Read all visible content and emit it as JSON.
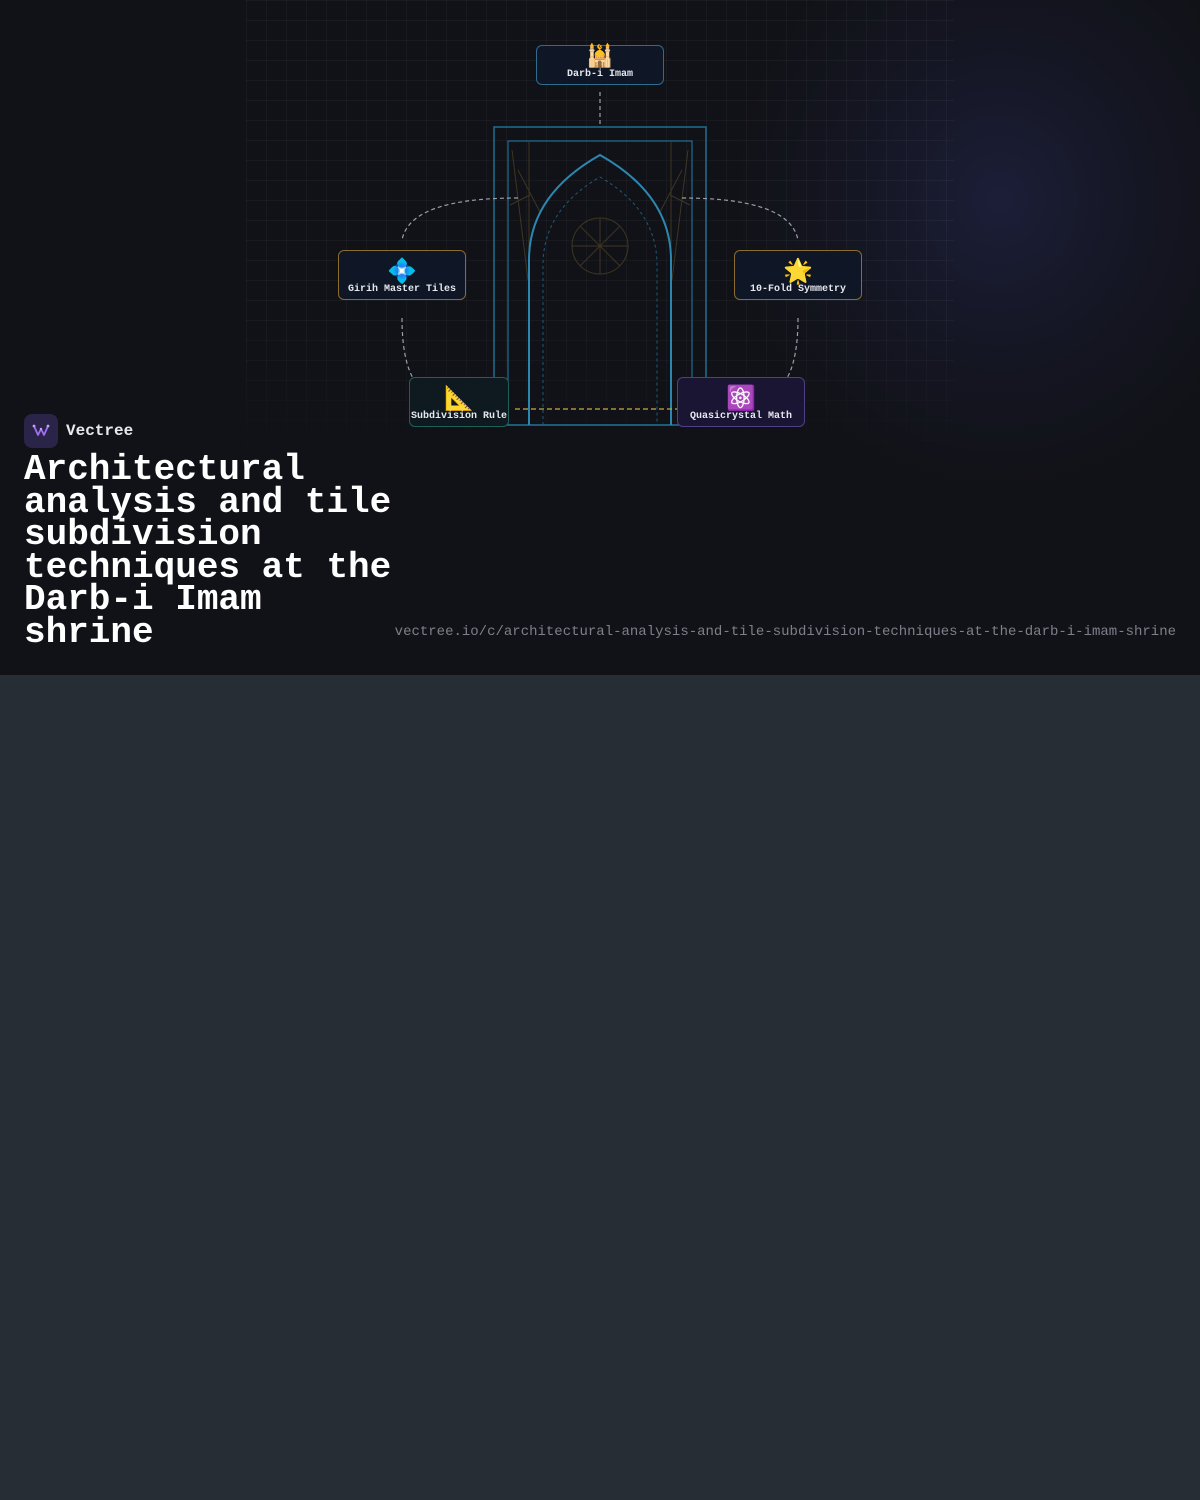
{
  "brand": {
    "name": "Vectree",
    "logo_icon": "vectree-logo-icon",
    "accent": "#a070f0"
  },
  "title": "Architectural analysis and tile subdivision techniques at the Darb-i Imam shrine",
  "url": "vectree.io/c/architectural-analysis-and-tile-subdivision-techniques-at-the-darb-i-imam-shrine",
  "nodes": {
    "darb": {
      "emoji": "🕌",
      "label": "Darb-i Imam",
      "border": "#2d6b8f"
    },
    "girih": {
      "emoji": "💠",
      "label": "Girih Master Tiles",
      "border": "#8a6c2c"
    },
    "fold": {
      "emoji": "🌟",
      "label": "10-Fold Symmetry",
      "border": "#8a6c2c"
    },
    "subdivision": {
      "emoji": "📐",
      "label": "Subdivision Rule",
      "border": "#1f5f57"
    },
    "quasi": {
      "emoji": "⚛️",
      "label": "Quasicrystal Math",
      "border": "#4f3f86"
    }
  },
  "colors": {
    "background": "#111217",
    "page": "#272d35",
    "arch": "#2b86b0",
    "connector": "#9aa0aa",
    "highlight_link": "#c9a640"
  }
}
